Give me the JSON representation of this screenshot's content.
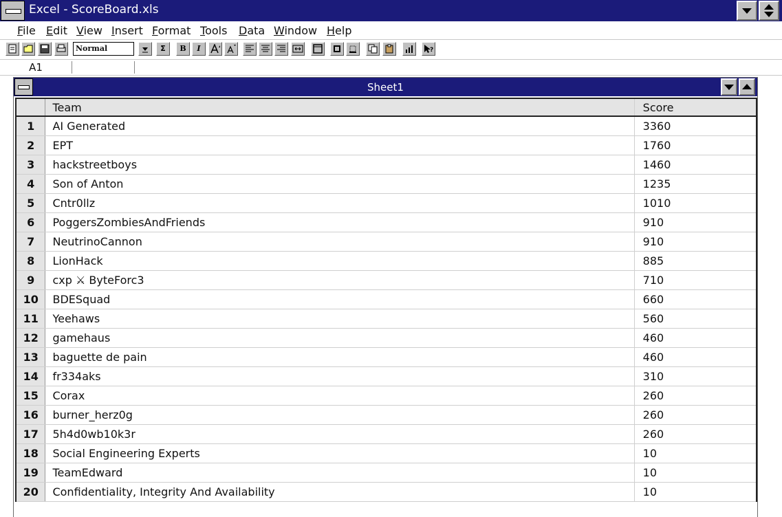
{
  "window": {
    "title": "Excel - ScoreBoard.xls"
  },
  "menu": [
    {
      "label": "File",
      "u": "F",
      "rest": "ile"
    },
    {
      "label": "Edit",
      "u": "E",
      "rest": "dit"
    },
    {
      "label": "View",
      "u": "V",
      "rest": "iew"
    },
    {
      "label": "Insert",
      "u": "I",
      "rest": "nsert"
    },
    {
      "label": "Format",
      "u": "F",
      "rest": "ormat"
    },
    {
      "label": "Tools",
      "u": "T",
      "rest": "ools"
    },
    {
      "label": "Data",
      "u": "D",
      "rest": "ata"
    },
    {
      "label": "Window",
      "u": "W",
      "rest": "indow"
    },
    {
      "label": "Help",
      "u": "H",
      "rest": "elp"
    }
  ],
  "toolbar": {
    "style_value": "Normal",
    "bold_label": "B",
    "italic_label": "I",
    "sum_label": "Σ"
  },
  "formula_bar": {
    "cell_ref": "A1",
    "content": ""
  },
  "sheet": {
    "title": "Sheet1",
    "headers": {
      "team": "Team",
      "score": "Score"
    },
    "rows": [
      {
        "n": "1",
        "team": "AI Generated",
        "score": "3360"
      },
      {
        "n": "2",
        "team": "EPT",
        "score": "1760"
      },
      {
        "n": "3",
        "team": "hackstreetboys",
        "score": "1460"
      },
      {
        "n": "4",
        "team": "Son of Anton",
        "score": "1235"
      },
      {
        "n": "5",
        "team": "Cntr0llz",
        "score": "1010"
      },
      {
        "n": "6",
        "team": "PoggersZombiesAndFriends",
        "score": "910"
      },
      {
        "n": "7",
        "team": "NeutrinoCannon",
        "score": "910"
      },
      {
        "n": "8",
        "team": "LionHack",
        "score": "885"
      },
      {
        "n": "9",
        "team": "cxp ⚔ ByteForc3",
        "score": "710"
      },
      {
        "n": "10",
        "team": "BDESquad",
        "score": "660"
      },
      {
        "n": "11",
        "team": "Yeehaws",
        "score": "560"
      },
      {
        "n": "12",
        "team": "gamehaus",
        "score": "460"
      },
      {
        "n": "13",
        "team": "baguette de pain",
        "score": "460"
      },
      {
        "n": "14",
        "team": "fr334aks",
        "score": "310"
      },
      {
        "n": "15",
        "team": "Corax",
        "score": "260"
      },
      {
        "n": "16",
        "team": "burner_herz0g",
        "score": "260"
      },
      {
        "n": "17",
        "team": "5h4d0wb10k3r",
        "score": "260"
      },
      {
        "n": "18",
        "team": "Social Engineering Experts",
        "score": "10"
      },
      {
        "n": "19",
        "team": "TeamEdward",
        "score": "10"
      },
      {
        "n": "20",
        "team": "Confidentiality, Integrity And Availability",
        "score": "10"
      }
    ]
  }
}
